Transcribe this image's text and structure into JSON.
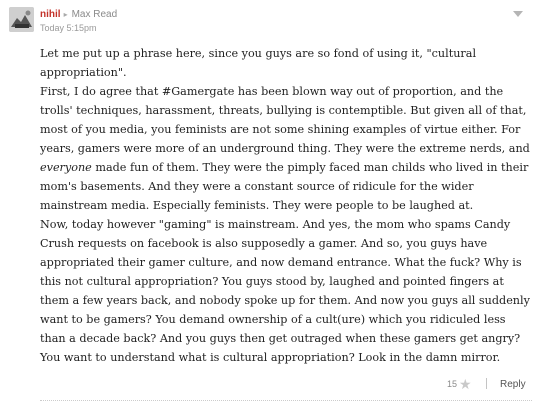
{
  "comment": {
    "author": "nihil",
    "reply_arrow": "▸",
    "reply_to": "Max Read",
    "time": "Today 5:15pm",
    "avatar_icon": "avatar-image",
    "paragraphs": [
      "Let me put up a phrase here, since you guys are so fond of using it, \"cultural appropriation\".",
      "First, I do agree that #Gamergate has been blown way out of proportion, and the trolls' techniques, harassment, threats, bullying is contemptible. But given all of that, most of you media, you feminists are not some shining examples of virtue either. For years, gamers were more of an underground thing. They were the extreme nerds, and everyone made fun of them. They were the pimply faced man childs who lived in their mom's basements. And they were a constant source of ridicule for the wider mainstream media. Especially feminists. They were people to be laughed at.",
      "Now, today however \"gaming\" is mainstream. And yes, the mom who spams Candy Crush requests on facebook is also supposedly a gamer. And so, you guys have appropriated their gamer culture, and now demand entrance. What the fuck? Why is this not cultural appropriation? You guys stood by, laughed and pointed fingers at them a few years back, and nobody spoke up for them. And now you guys all suddenly want to be gamers? You demand ownership of a cult(ure) which you ridiculed less than a decade back? And you guys then get outraged when these gamers get angry? You want to understand what is cultural appropriation? Look in the damn mirror."
    ],
    "emphasis_word": "everyone",
    "star_count": "15",
    "reply_label": "Reply"
  },
  "icons": {
    "star": "star-icon",
    "menu": "chevron-down-icon"
  }
}
